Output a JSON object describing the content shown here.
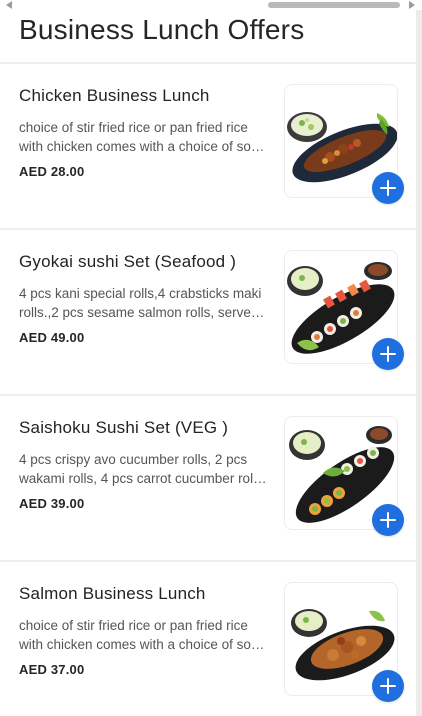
{
  "page": {
    "title": "Business Lunch Offers",
    "accent_color": "#1f6fe0"
  },
  "items": [
    {
      "name": "Chicken Business Lunch",
      "description": "choice of stir fried rice or pan fried rice with chicken comes with a choice of soup and salad",
      "price": "AED 28.00",
      "image_icon": "chicken-dish-icon"
    },
    {
      "name": "Gyokai sushi Set (Seafood )",
      "description": "4 pcs kani special rolls,4 crabsticks maki rolls.,2 pcs sesame salmon rolls, served with miso soup",
      "price": "AED 49.00",
      "image_icon": "sushi-platter-icon"
    },
    {
      "name": "Saishoku Sushi Set (VEG )",
      "description": "4 pcs crispy avo cucumber rolls, 2 pcs wakami rolls, 4 pcs carrot cucumber rolls, served with miso soup",
      "price": "AED 39.00",
      "image_icon": "veg-sushi-platter-icon"
    },
    {
      "name": "Salmon Business Lunch",
      "description": "choice of stir fried rice or pan fried rice with chicken comes with a choice of soup and salad",
      "price": "AED 37.00",
      "image_icon": "salmon-dish-icon"
    }
  ]
}
